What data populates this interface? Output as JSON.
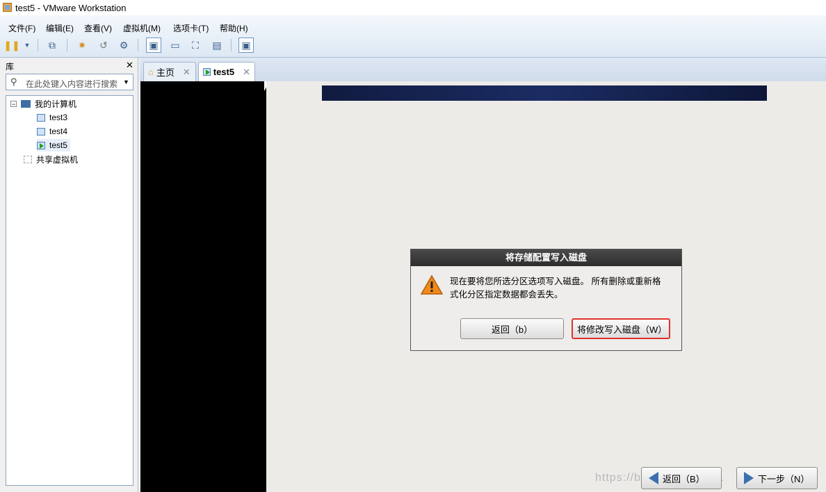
{
  "window": {
    "title": "test5 - VMware Workstation"
  },
  "menu": [
    "文件(F)",
    "编辑(E)",
    "查看(V)",
    "虚拟机(M)",
    "选项卡(T)",
    "帮助(H)"
  ],
  "toolbar": {
    "icons": [
      "pause-icon",
      "chevron-down-icon",
      "network-icon",
      "snapshot-icon",
      "revert-icon",
      "snapshot-manager-icon",
      "console-view-icon",
      "quick-switch-icon",
      "fullscreen-icon",
      "unity-icon",
      "thumbnail-icon"
    ]
  },
  "sidebar": {
    "title": "库",
    "close": "✕",
    "search_placeholder": "在此处键入内容进行搜索",
    "tree": {
      "root": "我的计算机",
      "vms": [
        "test3",
        "test4",
        "test5"
      ],
      "shared": "共享虚拟机"
    }
  },
  "tabs": [
    {
      "label": "主页",
      "active": false
    },
    {
      "label": "test5",
      "active": true
    }
  ],
  "dialog": {
    "title": "将存储配置写入磁盘",
    "message_line1": "现在要将您所选分区选项写入磁盘。 所有删除或重新格",
    "message_line2": "式化分区指定数据都会丢失。",
    "back_button": "返回（b）",
    "write_button": "将修改写入磁盘（W）"
  },
  "nav": {
    "back": "返回（B）",
    "next": "下一步（N）"
  },
  "watermark": "https://blog.csdn.net/...",
  "colors": {
    "highlight_border": "#e0302d",
    "banner": "#1b2c63"
  }
}
